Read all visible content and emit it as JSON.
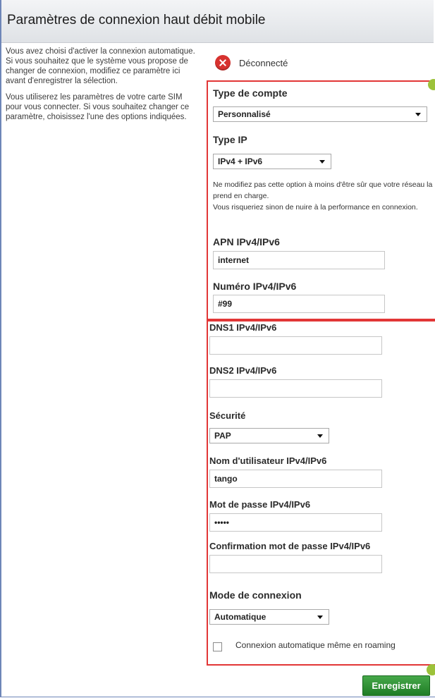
{
  "header": {
    "title": "Paramètres de connexion haut débit mobile"
  },
  "sidebar": {
    "paragraph1": "Vous avez choisi d'activer la connexion automatique. Si vous souhaitez que le système vous propose de changer de connexion, modifiez ce paramètre ici avant d'enregistrer la sélection.",
    "paragraph2": "Vous utiliserez les paramètres de votre carte SIM pour vous connecter. Si vous souhaitez changer ce paramètre, choisissez l'une des options indiquées."
  },
  "status": {
    "text": "Déconnecté",
    "icon": "error-x-icon",
    "color": "#d7322f"
  },
  "form": {
    "account_type": {
      "label": "Type de compte",
      "value": "Personnalisé"
    },
    "ip_type": {
      "label": "Type IP",
      "value": "IPv4 + IPv6"
    },
    "note": {
      "line1": "Ne modifiez pas cette option à moins d'être sûr que votre réseau la prend en charge.",
      "line2": "Vous risqueriez sinon de nuire à la performance en connexion."
    },
    "apn": {
      "label": "APN IPv4/IPv6",
      "value": "internet"
    },
    "number": {
      "label": "Numéro IPv4/IPv6",
      "value": "#99"
    },
    "dns1": {
      "label": "DNS1 IPv4/IPv6",
      "value": ""
    },
    "dns2": {
      "label": "DNS2 IPv4/IPv6",
      "value": ""
    },
    "security": {
      "label": "Sécurité",
      "value": "PAP"
    },
    "username": {
      "label": "Nom d'utilisateur IPv4/IPv6",
      "value": "tango"
    },
    "password": {
      "label": "Mot de passe IPv4/IPv6",
      "value": "•••••"
    },
    "password_confirm": {
      "label": "Confirmation mot de passe IPv4/IPv6",
      "value": ""
    },
    "connection_mode": {
      "label": "Mode de connexion",
      "value": "Automatique"
    },
    "roaming": {
      "label": "Connexion automatique même en roaming",
      "checked": false
    }
  },
  "actions": {
    "save_label": "Enregistrer"
  },
  "colors": {
    "highlight_border": "#e23636",
    "callout_dot": "#9cc23a",
    "button": "#2e8f32"
  }
}
